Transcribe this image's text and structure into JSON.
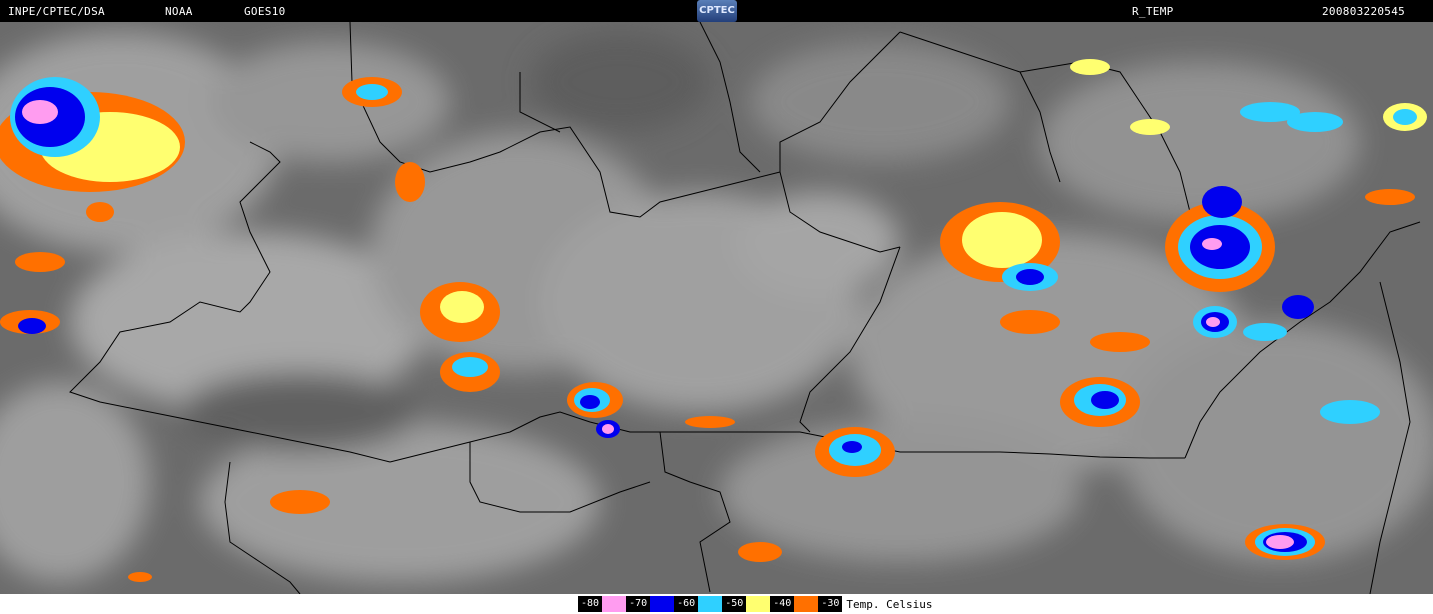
{
  "header": {
    "source": "INPE/CPTEC/DSA",
    "agency": "NOAA",
    "satellite": "GOES10",
    "logo_text": "CPTEC",
    "product": "R_TEMP",
    "datetime": "200803220545"
  },
  "legend": {
    "entries": [
      {
        "label": "-80",
        "color": "#ff9cf0"
      },
      {
        "label": "-70",
        "color": "#0000ee"
      },
      {
        "label": "-60",
        "color": "#2fd0ff"
      },
      {
        "label": "-50",
        "color": "#ffff70"
      },
      {
        "label": "-40",
        "color": "#ff7000"
      },
      {
        "label": "-30",
        "color": "#ffffff"
      }
    ],
    "units": "Temp. Celsius"
  },
  "colors": {
    "background_gray": "#6b6b6b",
    "cloud_light": "#b8b8b8",
    "border_line": "#000000"
  }
}
